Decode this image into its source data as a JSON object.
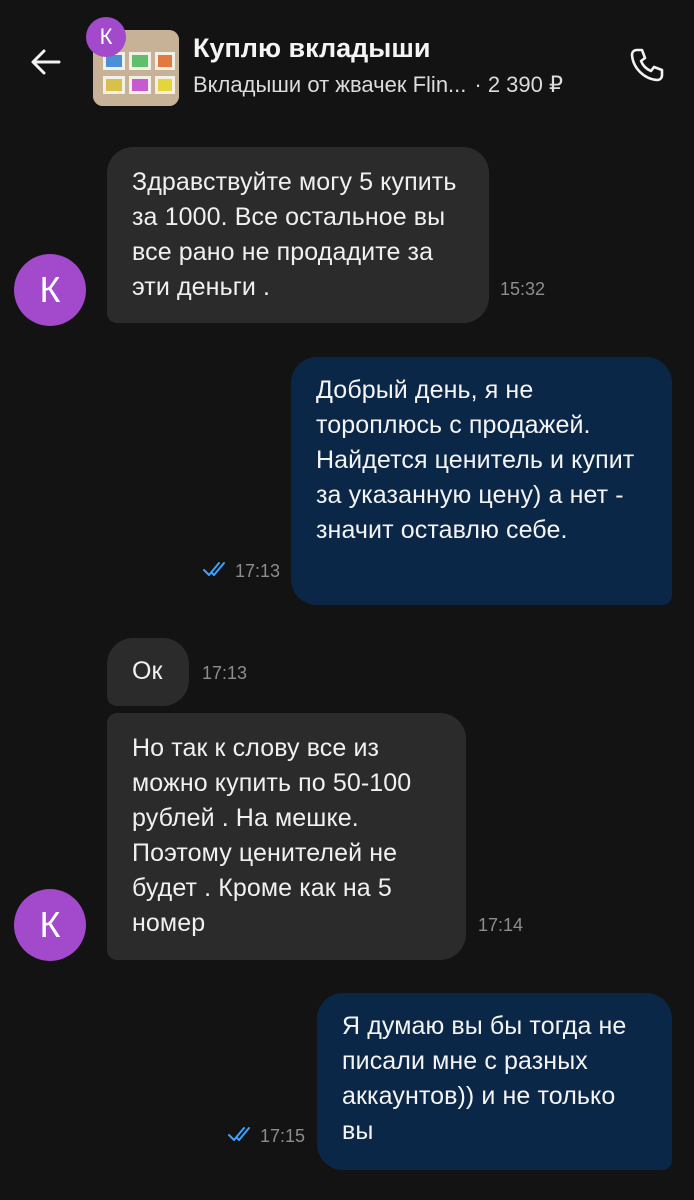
{
  "header": {
    "title": "Куплю вкладыши",
    "item_name": "Вкладыши от жвачек Flin...",
    "price": "· 2 390 ₽",
    "avatar_letter": "К"
  },
  "colors": {
    "background": "#131313",
    "incoming_bubble": "#2b2b2b",
    "outgoing_bubble": "#0b2748",
    "avatar": "#a24acb",
    "read_ticks": "#3ea0ff"
  },
  "icons": {
    "back": "arrow-left-icon",
    "call": "phone-icon",
    "read": "double-check-icon"
  },
  "messages": [
    {
      "direction": "in",
      "avatar": "К",
      "text": "Здравствуйте могу 5 купить за 1000. Все остальное вы все рано не продадите за эти деньги .",
      "time": "15:32"
    },
    {
      "direction": "out",
      "text": "Добрый день, я не тороплюсь с продажей. Найдется ценитель и купит за указанную цену) а нет - значит оставлю себе.",
      "time": "17:13",
      "read": true
    },
    {
      "direction": "in",
      "text": "Ок",
      "time": "17:13"
    },
    {
      "direction": "in",
      "avatar": "К",
      "text": "Но так к слову все из можно купить по 50-100 рублей . На мешке. Поэтому ценителей не будет . Кроме как на 5 номер",
      "time": "17:14"
    },
    {
      "direction": "out",
      "text": "Я думаю вы бы тогда не писали мне с разных аккаунтов)) и не только вы",
      "time": "17:15",
      "read": true
    }
  ]
}
